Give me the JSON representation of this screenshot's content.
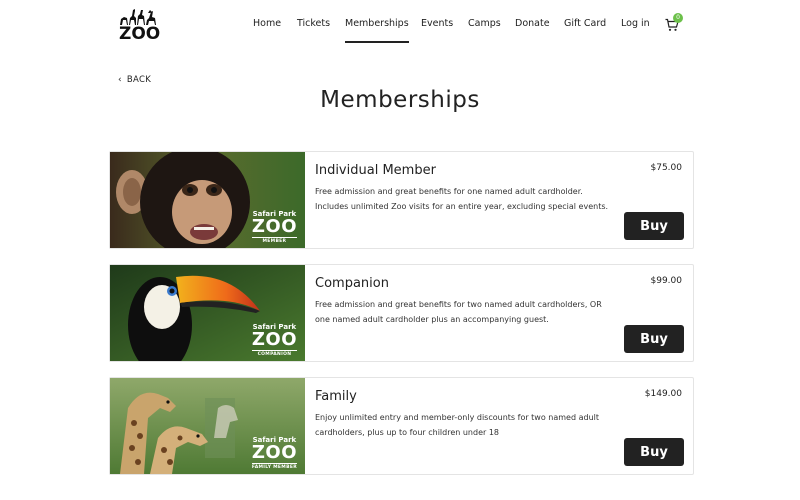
{
  "brand": {
    "logo_text": "ZOO"
  },
  "nav": {
    "items": [
      {
        "label": "Home"
      },
      {
        "label": "Tickets"
      },
      {
        "label": "Memberships"
      },
      {
        "label": "Events"
      },
      {
        "label": "Camps"
      },
      {
        "label": "Donate"
      },
      {
        "label": "Gift Card"
      },
      {
        "label": "Log in"
      }
    ],
    "active": "Memberships",
    "cart_count": "0"
  },
  "back_label": "BACK",
  "page_title": "Memberships",
  "memberships": [
    {
      "name": "Individual Member",
      "description": "Free admission and great benefits for one named adult cardholder. Includes unlimited Zoo visits for an entire year, excluding special events.",
      "price": "$75.00",
      "buy_label": "Buy",
      "image": {
        "animal": "chimpanzee",
        "badge_top": "Safari Park",
        "badge_zoo": "ZOO",
        "badge_sub": "MEMBER"
      }
    },
    {
      "name": "Companion",
      "description": "Free admission and great benefits for two named adult cardholders, OR one named adult cardholder plus an accompanying guest.",
      "price": "$99.00",
      "buy_label": "Buy",
      "image": {
        "animal": "toucan",
        "badge_top": "Safari Park",
        "badge_zoo": "ZOO",
        "badge_sub": "COMPANION"
      }
    },
    {
      "name": "Family",
      "description": "Enjoy unlimited entry and member-only discounts for two named adult cardholders, plus up to four children under 18",
      "price": "$149.00",
      "buy_label": "Buy",
      "image": {
        "animal": "giraffes",
        "badge_top": "Safari Park",
        "badge_zoo": "ZOO",
        "badge_sub": "FAMILY MEMBER"
      }
    }
  ],
  "colors": {
    "accent": "#222222",
    "cart_badge": "#6cc04a",
    "card_border": "#e4e4e4"
  },
  "icons": {
    "back": "chevron-left-icon",
    "cart": "cart-icon"
  }
}
